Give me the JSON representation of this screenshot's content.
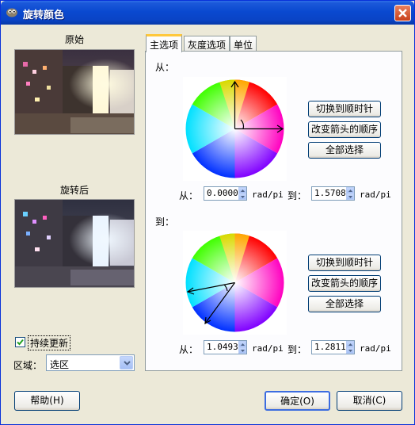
{
  "window": {
    "title": "旋转颜色"
  },
  "left": {
    "original_label": "原始",
    "rotated_label": "旋转后",
    "continuous_update": {
      "label": "持续更新",
      "checked": true
    },
    "area_label": "区域：",
    "area_value": "选区"
  },
  "tabs": [
    {
      "label": "主选项",
      "active": true
    },
    {
      "label": "灰度选项",
      "active": false
    },
    {
      "label": "单位",
      "active": false
    }
  ],
  "from_section": {
    "title": "从：",
    "buttons": [
      "切换到顺时针",
      "改变箭头的顺序",
      "全部选择"
    ],
    "from_label": "从：",
    "from_value": "0.0000",
    "to_label": "到：",
    "to_value": "1.5708",
    "unit": "rad/pi"
  },
  "to_section": {
    "title": "到：",
    "buttons": [
      "切换到顺时针",
      "改变箭头的顺序",
      "全部选择"
    ],
    "from_label": "从：",
    "from_value": "1.0493",
    "to_label": "到：",
    "to_value": "1.2811",
    "unit": "rad/pi"
  },
  "footer": {
    "help": "帮助(H)",
    "ok": "确定(O)",
    "cancel": "取消(C)"
  },
  "colors": {
    "title_bar": "#0a49d0",
    "face": "#ece9d8",
    "tab_highlight": "#ffc83c"
  }
}
